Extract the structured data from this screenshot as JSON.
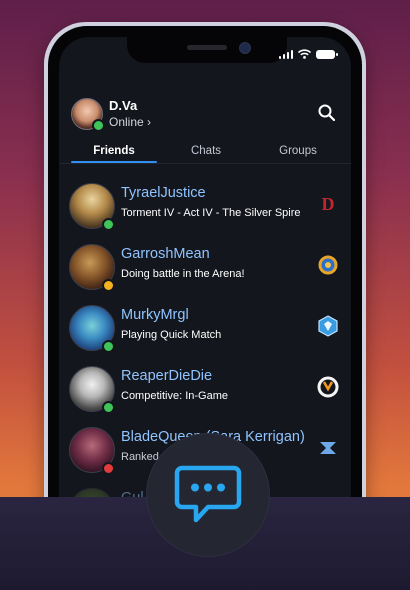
{
  "user": {
    "name": "D.Va",
    "status": "Online ›",
    "status_color": "#3fc45a"
  },
  "tabs": [
    {
      "label": "Friends",
      "active": true
    },
    {
      "label": "Chats",
      "active": false
    },
    {
      "label": "Groups",
      "active": false
    }
  ],
  "friends": [
    {
      "name": "TyraelJustice",
      "activity": "Torment IV - Act IV - The Silver Spire",
      "status": "online",
      "game_icon": "diablo-icon"
    },
    {
      "name": "GarroshMean",
      "activity": "Doing battle in the Arena!",
      "status": "away",
      "game_icon": "hearthstone-icon"
    },
    {
      "name": "MurkyMrgl",
      "activity": "Playing Quick Match",
      "status": "online",
      "game_icon": "heroes-of-the-storm-icon"
    },
    {
      "name": "ReaperDieDie",
      "activity": "Competitive: In-Game",
      "status": "online",
      "game_icon": "overwatch-icon"
    },
    {
      "name": "BladeQueen (Sara Kerrigan)",
      "activity": "Ranked",
      "status": "busy",
      "game_icon": "starcraft-icon"
    },
    {
      "name": "Gul",
      "activity": "",
      "status": "online",
      "game_icon": "game-icon"
    }
  ],
  "colors": {
    "accent": "#2f8ff0",
    "friend_name": "#8fc4ff",
    "online": "#3fc45a",
    "away": "#f2b31c",
    "busy": "#e23b3b"
  },
  "fab": {
    "icon": "chat-bubble-icon"
  }
}
